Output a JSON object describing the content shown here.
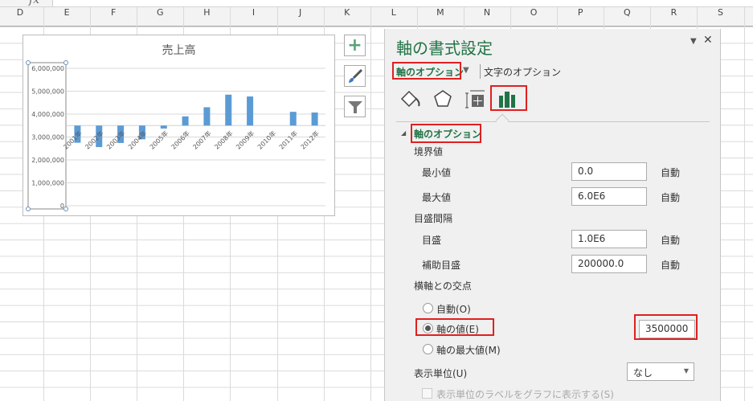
{
  "formula_bar": {
    "fx_label": "fx"
  },
  "columns": [
    "D",
    "E",
    "F",
    "G",
    "H",
    "I",
    "J",
    "K",
    "L",
    "M",
    "N",
    "O",
    "P",
    "Q",
    "R",
    "S"
  ],
  "chart_buttons": {
    "add": "plus-icon",
    "style": "brush-icon",
    "filter": "filter-icon"
  },
  "chart_data": {
    "type": "bar",
    "title": "売上高",
    "categories": [
      "2001年",
      "2002年",
      "2003年",
      "2004年",
      "2005年",
      "2006年",
      "2007年",
      "2008年",
      "2009年",
      "2010年",
      "2011年",
      "2012年"
    ],
    "values": [
      2750000,
      2560000,
      2740000,
      2900000,
      3370000,
      3900000,
      4300000,
      4850000,
      4770000,
      3500000,
      4100000,
      4070000
    ],
    "y_ticks": [
      "0",
      "1,000,000",
      "2,000,000",
      "3,000,000",
      "4,000,000",
      "5,000,000",
      "6,000,000"
    ],
    "ylim": [
      0,
      6000000
    ],
    "crosses_at": 3500000,
    "bar_color": "#5b9bd5",
    "grid": true
  },
  "panel": {
    "title": "軸の書式設定",
    "tab_axis_options": "軸のオプション",
    "tab_text_options": "文字のオプション",
    "section_title": "軸のオプション",
    "bounds_label": "境界値",
    "min_label": "最小値",
    "min_value": "0.0",
    "min_auto": "自動",
    "max_label": "最大値",
    "max_value": "6.0E6",
    "max_auto": "自動",
    "units_label": "目盛間隔",
    "major_label": "目盛",
    "major_value": "1.0E6",
    "major_auto": "自動",
    "minor_label": "補助目盛",
    "minor_value": "200000.0",
    "minor_auto": "自動",
    "cross_label": "横軸との交点",
    "radio_auto": "自動(O)",
    "radio_value": "軸の値(E)",
    "radio_max": "軸の最大値(M)",
    "cross_value": "3500000",
    "display_units_label": "表示単位(U)",
    "display_units_value": "なし",
    "show_units_label": "表示単位のラベルをグラフに表示する(S)",
    "accent": "#217346"
  }
}
